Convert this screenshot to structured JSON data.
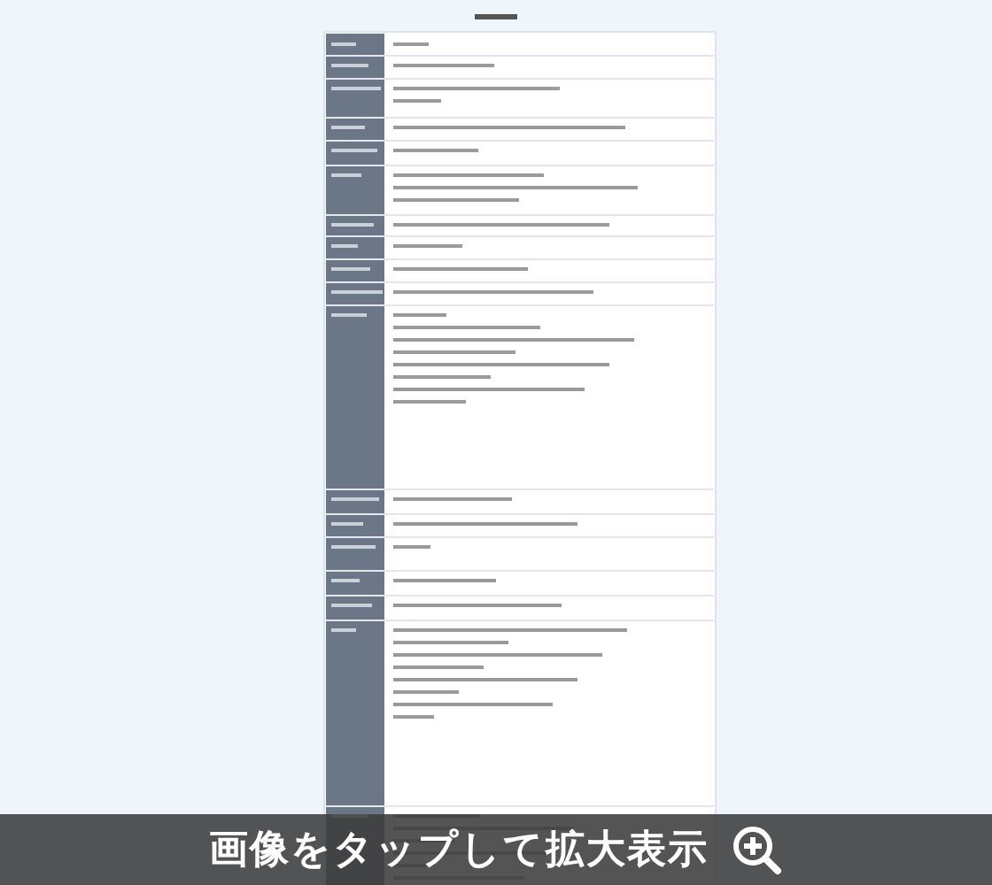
{
  "banner": {
    "text": "画像をタップして拡大表示"
  }
}
